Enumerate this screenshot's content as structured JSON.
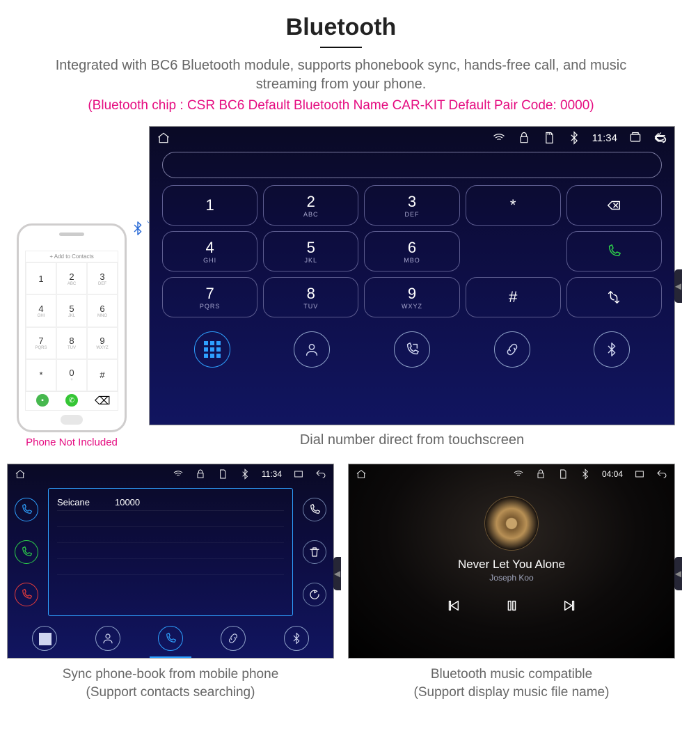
{
  "heading": "Bluetooth",
  "desc": "Integrated with BC6 Bluetooth module, supports phonebook sync, hands-free call, and music streaming from your phone.",
  "spec": "(Bluetooth chip : CSR BC6     Default Bluetooth Name CAR-KIT     Default Pair Code: 0000)",
  "phone_caption": "Phone Not Included",
  "phone": {
    "header": "+   Add to Contacts",
    "pad": [
      {
        "n": "1",
        "s": ""
      },
      {
        "n": "2",
        "s": "ABC"
      },
      {
        "n": "3",
        "s": "DEF"
      },
      {
        "n": "4",
        "s": "GHI"
      },
      {
        "n": "5",
        "s": "JKL"
      },
      {
        "n": "6",
        "s": "MNO"
      },
      {
        "n": "7",
        "s": "PQRS"
      },
      {
        "n": "8",
        "s": "TUV"
      },
      {
        "n": "9",
        "s": "WXYZ"
      },
      {
        "n": "*",
        "s": ""
      },
      {
        "n": "0",
        "s": "+"
      },
      {
        "n": "#",
        "s": ""
      }
    ]
  },
  "hu": {
    "time": "11:34",
    "keys": [
      {
        "n": "1",
        "s": ""
      },
      {
        "n": "2",
        "s": "ABC"
      },
      {
        "n": "3",
        "s": "DEF"
      },
      {
        "n": "*",
        "s": ""
      },
      {
        "n": "del",
        "s": ""
      },
      {
        "n": "4",
        "s": "GHI"
      },
      {
        "n": "5",
        "s": "JKL"
      },
      {
        "n": "6",
        "s": "MBO"
      },
      {
        "n": "",
        "s": ""
      },
      {
        "n": "call",
        "s": ""
      },
      {
        "n": "7",
        "s": "PQRS"
      },
      {
        "n": "8",
        "s": "TUV"
      },
      {
        "n": "9",
        "s": "WXYZ"
      },
      {
        "n": "#",
        "s": ""
      },
      {
        "n": "swap",
        "s": ""
      }
    ],
    "caption": "Dial number direct from touchscreen"
  },
  "pb": {
    "time": "11:34",
    "contact": {
      "name": "Seicane",
      "num": "10000"
    },
    "caption_l1": "Sync phone-book from mobile phone",
    "caption_l2": "(Support contacts searching)"
  },
  "music": {
    "time": "04:04",
    "track": "Never Let You Alone",
    "artist": "Joseph Koo",
    "caption_l1": "Bluetooth music compatible",
    "caption_l2": "(Support display music file name)"
  }
}
